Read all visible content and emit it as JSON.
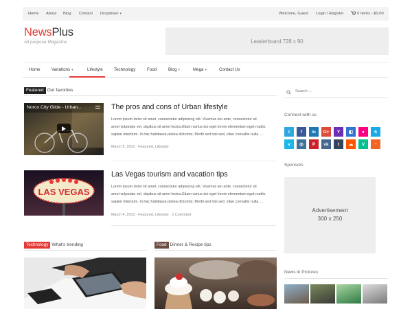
{
  "topbar": {
    "left_links": [
      "Home",
      "About",
      "Blog",
      "Contact"
    ],
    "dropdown_label": "Dropdown",
    "welcome": "Welcome, Guest",
    "login": "Login / Register",
    "cart": "0 Items - $0.00"
  },
  "header": {
    "logo_accent": "News",
    "logo_rest": "Plus",
    "tagline": "All purpose Magazine",
    "leaderboard": "Leaderboard 728 x 90"
  },
  "nav": {
    "items": [
      "Home",
      "Variations",
      "Lifestyle",
      "Technology",
      "Food",
      "Blog",
      "Mega",
      "Contact Us"
    ],
    "active": "Variations"
  },
  "featured": {
    "badge": "Featured",
    "title": "Our favorites",
    "articles": [
      {
        "video_title": "Norco City Glide - Urban...",
        "title": "The pros and cons of Urban lifestyle",
        "excerpt_lines": [
          "Lorem ipsum dolor sit amet, consectetur adipiscing elit. Vivamus leo ante, consectetur sit",
          "amet vulputate vel, dapibus sit amet lectus.Etiam varius dui eget lorem elementum eget mattis",
          "sapien interdum. In hac habitasse platea dictumst. Morbi sed nisi sed, vitae convallis nulla. ..."
        ],
        "meta": "March 5, 2013 · Featured, Lifestyle"
      },
      {
        "title": "Las Vegas tourism and vacation tips",
        "excerpt_lines": [
          "Lorem ipsum dolor sit amet, consectetur adipiscing elit. Vivamus leo ante, consectetur sit",
          "amet vulputate vel, dapibus sit amet lectus.Etiam varius dui eget lorem elementum eget mattis",
          "sapien interdum. In hac habitasse platea dictumst. Morbi sed nisi sed, vitae convallis nulla. ..."
        ],
        "meta": "March 4, 2013 · Featured, Lifestyle · 1 Comment"
      }
    ]
  },
  "technology": {
    "badge": "Technology",
    "title": "What's trending"
  },
  "food": {
    "badge": "Food",
    "title": "Dinner & Recipe tips"
  },
  "sidebar": {
    "search_placeholder": "Search ...",
    "connect_title": "Connect with us",
    "social": [
      {
        "name": "twitter",
        "glyph": "t",
        "color": "#2fa7e0"
      },
      {
        "name": "facebook",
        "glyph": "f",
        "color": "#3b5998"
      },
      {
        "name": "linkedin",
        "glyph": "in",
        "color": "#1f78b4"
      },
      {
        "name": "google-plus",
        "glyph": "G+",
        "color": "#dd4b39"
      },
      {
        "name": "yahoo",
        "glyph": "Y",
        "color": "#6b2fb5"
      },
      {
        "name": "delicious",
        "glyph": "◧",
        "color": "#3274d1"
      },
      {
        "name": "flickr",
        "glyph": "●",
        "color": "#ff0084"
      },
      {
        "name": "skype",
        "glyph": "S",
        "color": "#18a9e8"
      },
      {
        "name": "vimeo",
        "glyph": "v",
        "color": "#1ab7ea"
      },
      {
        "name": "instagram",
        "glyph": "◎",
        "color": "#3f729b"
      },
      {
        "name": "pinterest",
        "glyph": "P",
        "color": "#cb2027"
      },
      {
        "name": "vk",
        "glyph": "vk",
        "color": "#45668e"
      },
      {
        "name": "tumblr",
        "glyph": "t",
        "color": "#35465c"
      },
      {
        "name": "soundcloud",
        "glyph": "☁",
        "color": "#ff5500"
      },
      {
        "name": "vine",
        "glyph": "V",
        "color": "#00bf8f"
      },
      {
        "name": "rss",
        "glyph": "◔",
        "color": "#f26522"
      }
    ],
    "sponsors_title": "Sponsors",
    "ad_line1": "Advertisement",
    "ad_line2": "300 x 250",
    "pictures_title": "News in Pictures"
  },
  "colors": {
    "accent": "#e53935",
    "food_badge": "#6d4c41",
    "badge_dark": "#222222"
  }
}
